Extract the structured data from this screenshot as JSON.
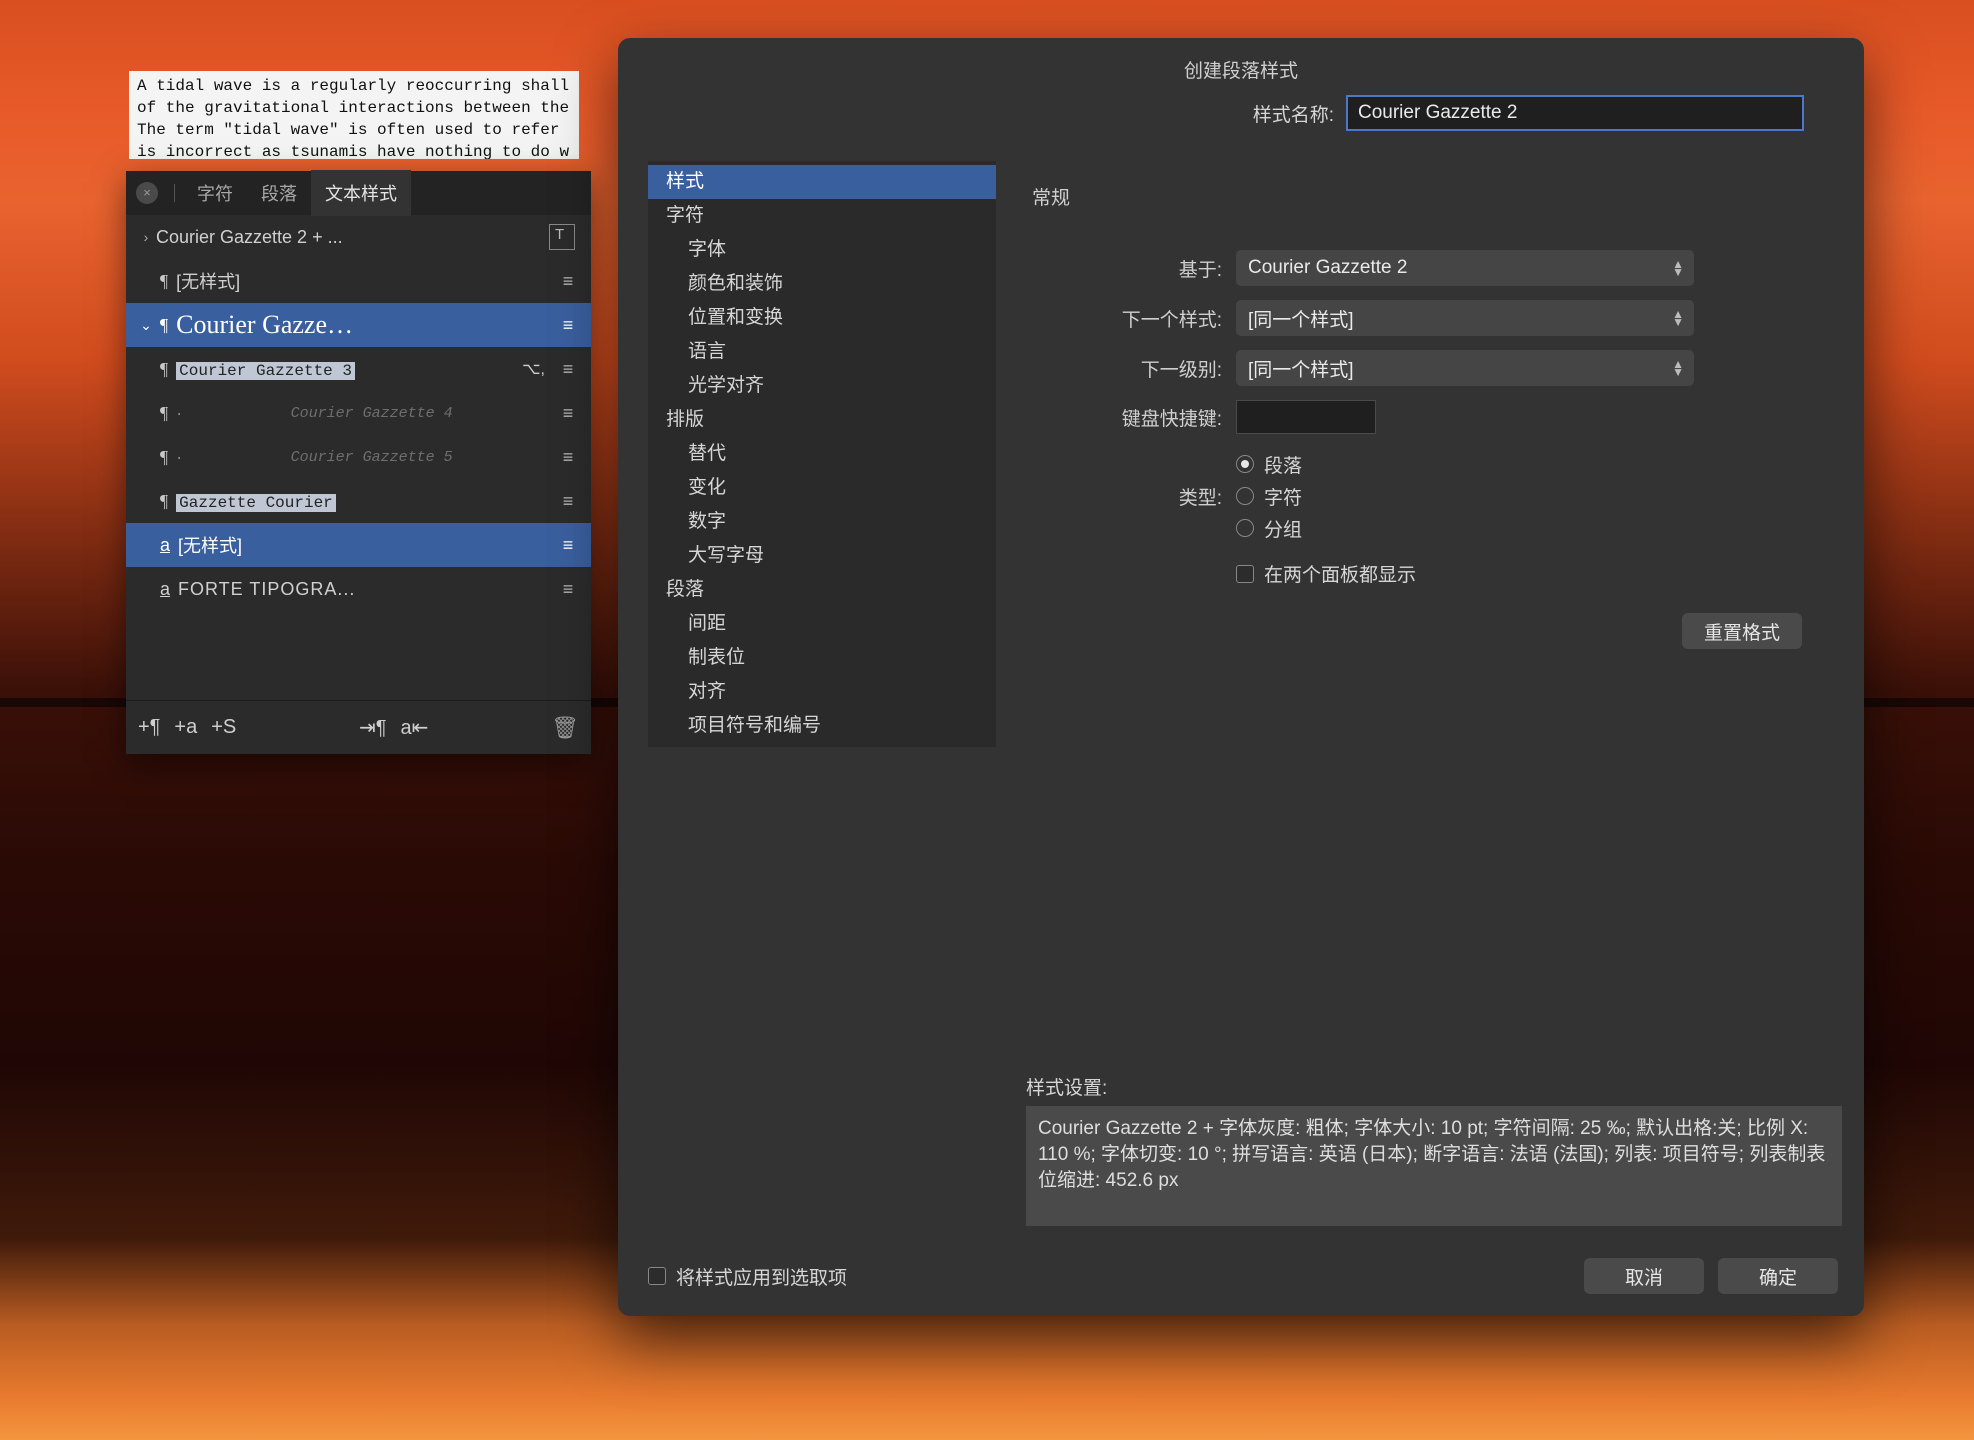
{
  "document_text": "A tidal wave is a regularly reoccurring shall\nof the gravitational interactions between the\nThe term \"tidal wave\" is often used to refer \nis incorrect as tsunamis have nothing to do w",
  "styles_panel": {
    "tabs": {
      "char": "字符",
      "para": "段落",
      "text_styles": "文本样式"
    },
    "rows": {
      "current": "Courier Gazzette 2 + ...",
      "no_style_para": "[无样式]",
      "group": "Courier Gazze…",
      "child1": "Courier Gazzette 3",
      "child1_kbd": "⌥,",
      "child2_prefix": "·",
      "child2": "Courier Gazzette 4",
      "child3_prefix": "·",
      "child3": "Courier Gazzette 5",
      "child4": "Gazzette Courier",
      "no_style_char": "[无样式]",
      "forte": "FORTE TIPOGRA..."
    },
    "footer": {
      "add_para": "+¶",
      "add_char": "+a",
      "add_style": "+S"
    }
  },
  "dialog": {
    "title": "创建段落样式",
    "name_label": "样式名称:",
    "name_value": "Courier Gazzette 2",
    "categories": [
      {
        "label": "样式",
        "selected": true
      },
      {
        "label": "字符",
        "header": true
      },
      {
        "label": "字体",
        "child": true
      },
      {
        "label": "颜色和装饰",
        "child": true
      },
      {
        "label": "位置和变换",
        "child": true
      },
      {
        "label": "语言",
        "child": true
      },
      {
        "label": "光学对齐",
        "child": true
      },
      {
        "label": "排版",
        "header": true
      },
      {
        "label": "替代",
        "child": true
      },
      {
        "label": "变化",
        "child": true
      },
      {
        "label": "数字",
        "child": true
      },
      {
        "label": "大写字母",
        "child": true
      },
      {
        "label": "段落",
        "header": true
      },
      {
        "label": "间距",
        "child": true
      },
      {
        "label": "制表位",
        "child": true
      },
      {
        "label": "对齐",
        "child": true
      },
      {
        "label": "项目符号和编号",
        "child": true
      }
    ],
    "general_label": "常规",
    "based_on_label": "基于:",
    "based_on_value": "Courier Gazzette 2",
    "next_style_label": "下一个样式:",
    "next_style_value": "[同一个样式]",
    "next_level_label": "下一级别:",
    "next_level_value": "[同一个样式]",
    "shortcut_label": "键盘快捷键:",
    "type_label": "类型:",
    "type_options": {
      "para": "段落",
      "char": "字符",
      "group": "分组"
    },
    "show_both_label": "在两个面板都显示",
    "reset_label": "重置格式",
    "settings_label": "样式设置:",
    "settings_text": "Courier Gazzette 2 + 字体灰度: 粗体; 字体大小:  10 pt; 字符间隔: 25 ‰; 默认出格:关; 比例 X: 110 %; 字体切变: 10 °; 拼写语言: 英语 (日本); 断字语言: 法语 (法国); 列表: 项目符号; 列表制表位缩进: 452.6 px",
    "apply_checkbox_label": "将样式应用到选取项",
    "cancel": "取消",
    "ok": "确定"
  }
}
